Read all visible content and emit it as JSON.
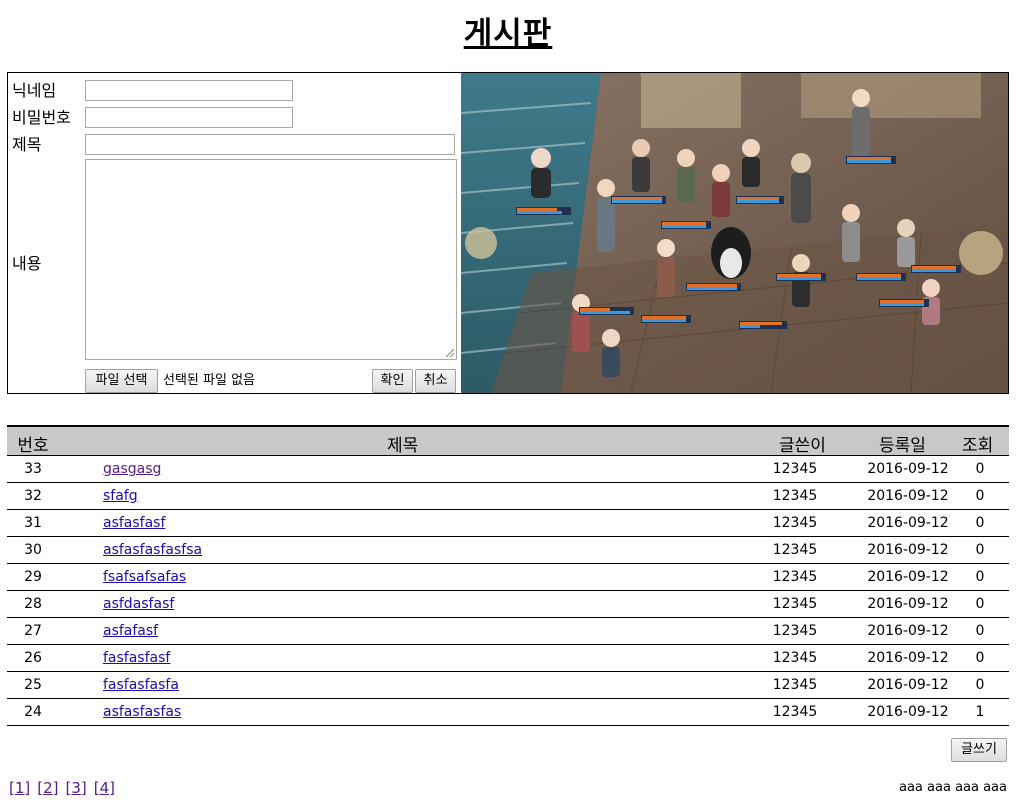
{
  "page": {
    "title": "게시판"
  },
  "form": {
    "nickname_label": "닉네임",
    "password_label": "비밀번호",
    "subject_label": "제목",
    "content_label": "내용",
    "nickname_value": "",
    "password_value": "",
    "subject_value": "",
    "content_value": "",
    "file_button_label": "파일 선택",
    "file_status": "선택된 파일 없음",
    "confirm_label": "확인",
    "cancel_label": "취소"
  },
  "board": {
    "columns": {
      "no": "번호",
      "title": "제목",
      "writer": "글쓴이",
      "date": "등록일",
      "views": "조회"
    },
    "rows": [
      {
        "no": "33",
        "title": "gasgasg",
        "writer": "12345",
        "date": "2016-09-12",
        "views": "0"
      },
      {
        "no": "32",
        "title": "sfafg",
        "writer": "12345",
        "date": "2016-09-12",
        "views": "0"
      },
      {
        "no": "31",
        "title": "asfasfasf",
        "writer": "12345",
        "date": "2016-09-12",
        "views": "0"
      },
      {
        "no": "30",
        "title": "asfasfasfasfsa",
        "writer": "12345",
        "date": "2016-09-12",
        "views": "0"
      },
      {
        "no": "29",
        "title": "fsafsafsafas",
        "writer": "12345",
        "date": "2016-09-12",
        "views": "0"
      },
      {
        "no": "28",
        "title": "asfdasfasf",
        "writer": "12345",
        "date": "2016-09-12",
        "views": "0"
      },
      {
        "no": "27",
        "title": "asfafasf",
        "writer": "12345",
        "date": "2016-09-12",
        "views": "0"
      },
      {
        "no": "26",
        "title": "fasfasfasf",
        "writer": "12345",
        "date": "2016-09-12",
        "views": "0"
      },
      {
        "no": "25",
        "title": "fasfasfasfa",
        "writer": "12345",
        "date": "2016-09-12",
        "views": "0"
      },
      {
        "no": "24",
        "title": "asfasfasfas",
        "writer": "12345",
        "date": "2016-09-12",
        "views": "1"
      }
    ],
    "write_button_label": "글쓰기"
  },
  "pager": {
    "pages": [
      "[1]",
      "[2]",
      "[3]",
      "[4]"
    ]
  },
  "footer": {
    "text": "aaa aaa aaa aaa"
  },
  "colors": {
    "link": "#1a0dab",
    "visited": "#551a8b",
    "header_bg": "#c8c8c8"
  }
}
